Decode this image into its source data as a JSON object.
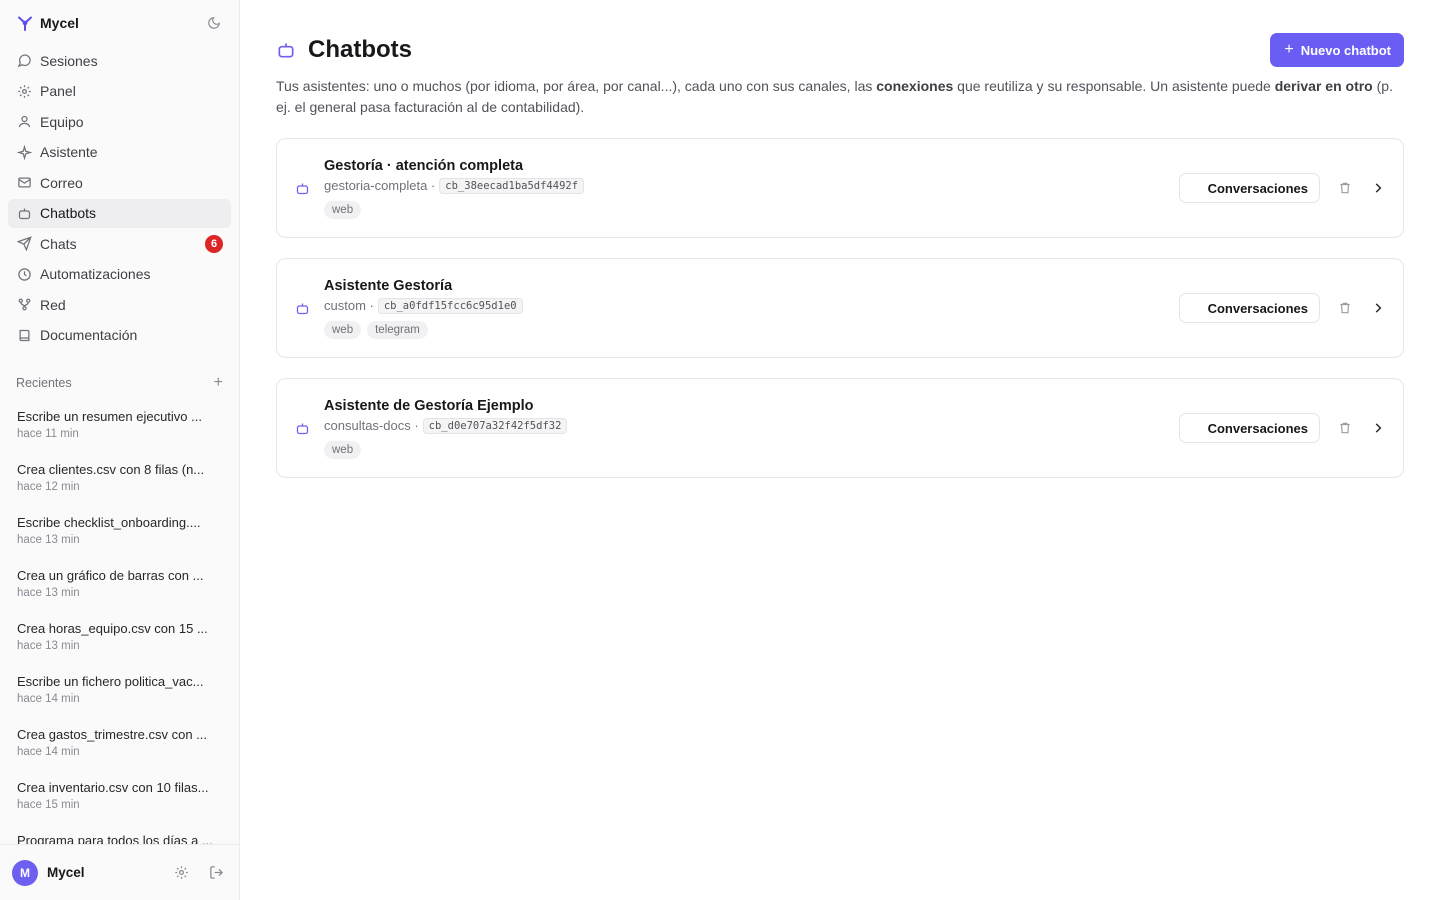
{
  "brand": {
    "name": "Mycel"
  },
  "nav": [
    {
      "label": "Sesiones",
      "icon": "chat-bubble-icon"
    },
    {
      "label": "Panel",
      "icon": "gear-icon"
    },
    {
      "label": "Equipo",
      "icon": "user-icon"
    },
    {
      "label": "Asistente",
      "icon": "sparkle-icon"
    },
    {
      "label": "Correo",
      "icon": "mail-icon"
    },
    {
      "label": "Chatbots",
      "icon": "bot-icon",
      "active": true
    },
    {
      "label": "Chats",
      "icon": "send-icon",
      "badge": "6"
    },
    {
      "label": "Automatizaciones",
      "icon": "clock-icon"
    },
    {
      "label": "Red",
      "icon": "network-icon"
    },
    {
      "label": "Documentación",
      "icon": "book-icon"
    }
  ],
  "recent": {
    "title": "Recientes",
    "items": [
      {
        "text": "Escribe un resumen ejecutivo ...",
        "time": "hace 11 min"
      },
      {
        "text": "Crea clientes.csv con 8 filas (n...",
        "time": "hace 12 min"
      },
      {
        "text": "Escribe checklist_onboarding....",
        "time": "hace 13 min"
      },
      {
        "text": "Crea un gráfico de barras con ...",
        "time": "hace 13 min"
      },
      {
        "text": "Crea horas_equipo.csv con 15 ...",
        "time": "hace 13 min"
      },
      {
        "text": "Escribe un fichero politica_vac...",
        "time": "hace 14 min"
      },
      {
        "text": "Crea gastos_trimestre.csv con ...",
        "time": "hace 14 min"
      },
      {
        "text": "Crea inventario.csv con 10 filas...",
        "time": "hace 15 min"
      },
      {
        "text": "Programa para todos los días a ...",
        "time": ""
      }
    ]
  },
  "user": {
    "initial": "M",
    "name": "Mycel"
  },
  "page": {
    "title": "Chatbots",
    "new_button": "Nuevo chatbot",
    "desc": {
      "p1": "Tus asistentes: uno o muchos (por idioma, por área, por canal...), cada uno con sus canales, las ",
      "b1": "conexiones",
      "p2": " que reutiliza y su responsable. Un asistente puede ",
      "b2": "derivar en otro",
      "p3": " (p. ej. el general pasa facturación al de contabilidad)."
    }
  },
  "bots": [
    {
      "name": "Gestoría · atención completa",
      "slug": "gestoria-completa ·",
      "id": "cb_38eecad1ba5df4492f",
      "tags": [
        "web"
      ],
      "action": "Conversaciones"
    },
    {
      "name": "Asistente Gestoría",
      "slug": "custom ·",
      "id": "cb_a0fdf15fcc6c95d1e0",
      "tags": [
        "web",
        "telegram"
      ],
      "action": "Conversaciones"
    },
    {
      "name": "Asistente de Gestoría Ejemplo",
      "slug": "consultas-docs ·",
      "id": "cb_d0e707a32f42f5df32",
      "tags": [
        "web"
      ],
      "action": "Conversaciones"
    }
  ]
}
